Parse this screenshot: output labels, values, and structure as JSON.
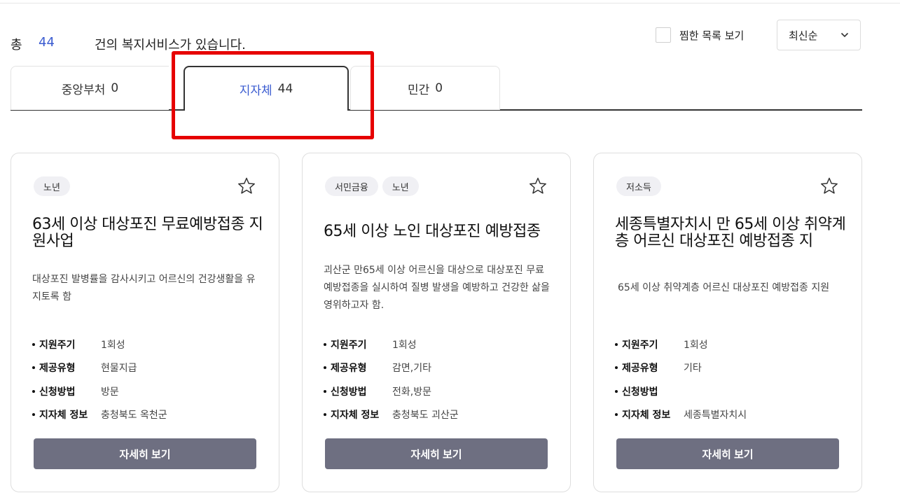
{
  "summary": {
    "total_label": "총",
    "count": "44",
    "suffix": "건의 복지서비스가 있습니다."
  },
  "wishlist": {
    "label": "찜한 목록 보기"
  },
  "sort": {
    "selected": "최신순"
  },
  "tabs": [
    {
      "label": "중앙부처",
      "count": "0"
    },
    {
      "label": "지자체",
      "count": "44"
    },
    {
      "label": "민간",
      "count": "0"
    }
  ],
  "colors": {
    "accent": "#3a5bd0",
    "button": "#6e6f81",
    "highlight": "#e60000",
    "tag_bg": "#f0f0f4"
  },
  "cards": [
    {
      "tags": [
        "노년"
      ],
      "title": "63세 이상 대상포진 무료예방접종 지원사업",
      "desc": "대상포진 발병률을 감사시키고 어르신의 건강생활을 유지토록 함",
      "info": [
        {
          "key": "지원주기",
          "val": "1회성"
        },
        {
          "key": "제공유형",
          "val": "현물지급"
        },
        {
          "key": "신청방법",
          "val": "방문"
        },
        {
          "key": "지자체 정보",
          "val": "충청북도 옥천군"
        }
      ],
      "button": "자세히 보기"
    },
    {
      "tags": [
        "서민금융",
        "노년"
      ],
      "title": "65세 이상 노인 대상포진 예방접종",
      "desc": "괴산군 만65세 이상 어르신을 대상으로 대상포진 무료 예방접종을 실시하여 질병 발생을 예방하고 건강한 삶을 영위하고자 함.",
      "info": [
        {
          "key": "지원주기",
          "val": "1회성"
        },
        {
          "key": "제공유형",
          "val": "감면,기타"
        },
        {
          "key": "신청방법",
          "val": "전화,방문"
        },
        {
          "key": "지자체 정보",
          "val": "충청북도 괴산군"
        }
      ],
      "button": "자세히 보기"
    },
    {
      "tags": [
        "저소득"
      ],
      "title": "세종특별자치시 만 65세 이상 취약계층 어르신 대상포진 예방접종 지",
      "desc": "65세 이상 취약계층 어르신 대상포진 예방접종 지원",
      "info": [
        {
          "key": "지원주기",
          "val": "1회성"
        },
        {
          "key": "제공유형",
          "val": "기타"
        },
        {
          "key": "신청방법",
          "val": ""
        },
        {
          "key": "지자체 정보",
          "val": "세종특별자치시"
        }
      ],
      "button": "자세히 보기"
    }
  ]
}
